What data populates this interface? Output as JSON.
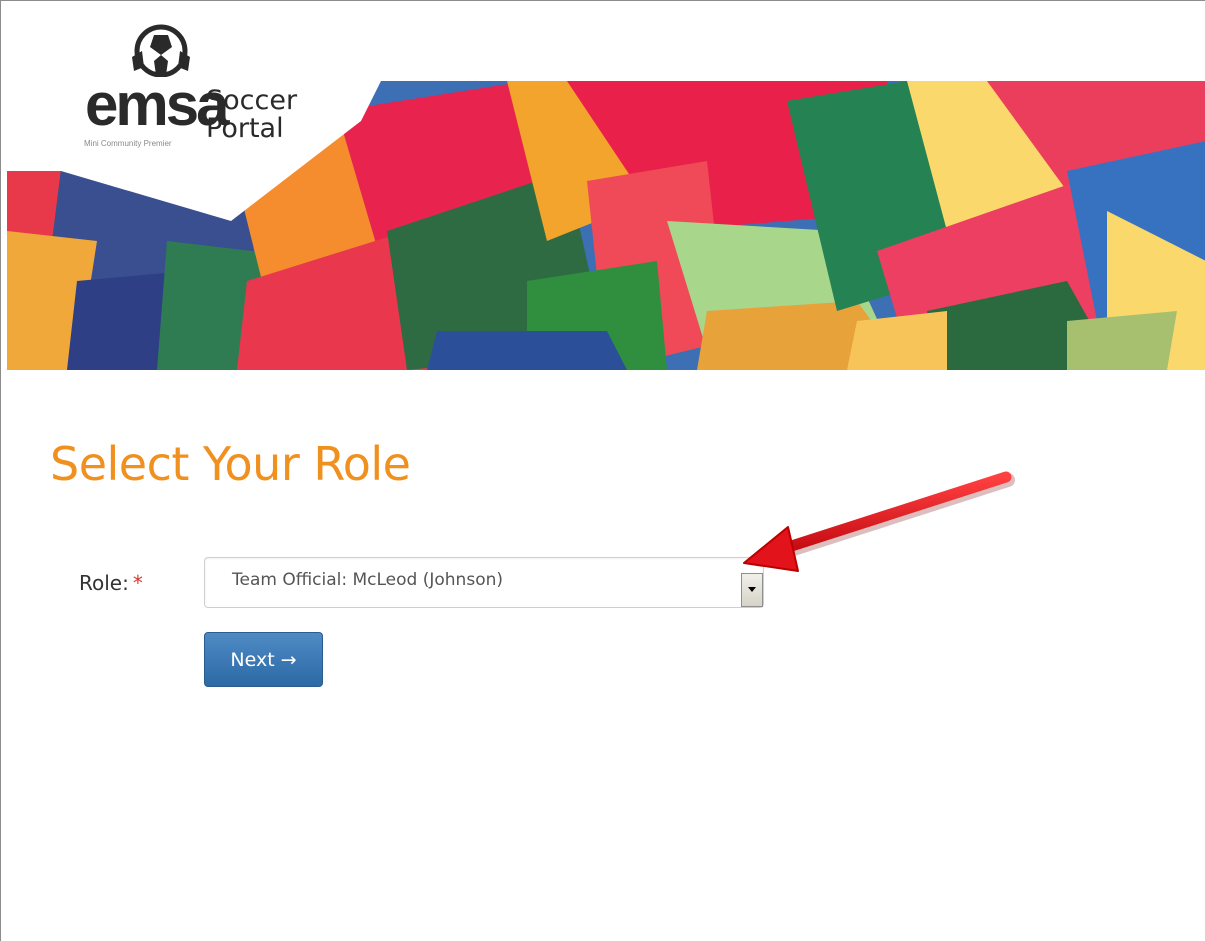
{
  "header": {
    "logo_name": "emsa",
    "logo_tagline": "Mini Community Premier",
    "portal_title": "Soccer Portal",
    "portal_line1": "Soccer",
    "portal_line2": "Portal",
    "logo_icon": "soccer-ball-icon"
  },
  "page": {
    "title": "Select Your Role"
  },
  "form": {
    "role_label": "Role:",
    "required_mark": "*",
    "role_selected": "Team Official: McLeod (Johnson)",
    "next_label": "Next →"
  },
  "colors": {
    "title": "#f0901e",
    "button": "#2b6aa6",
    "required": "#d9342b",
    "annotation_arrow": "#e3131b"
  }
}
